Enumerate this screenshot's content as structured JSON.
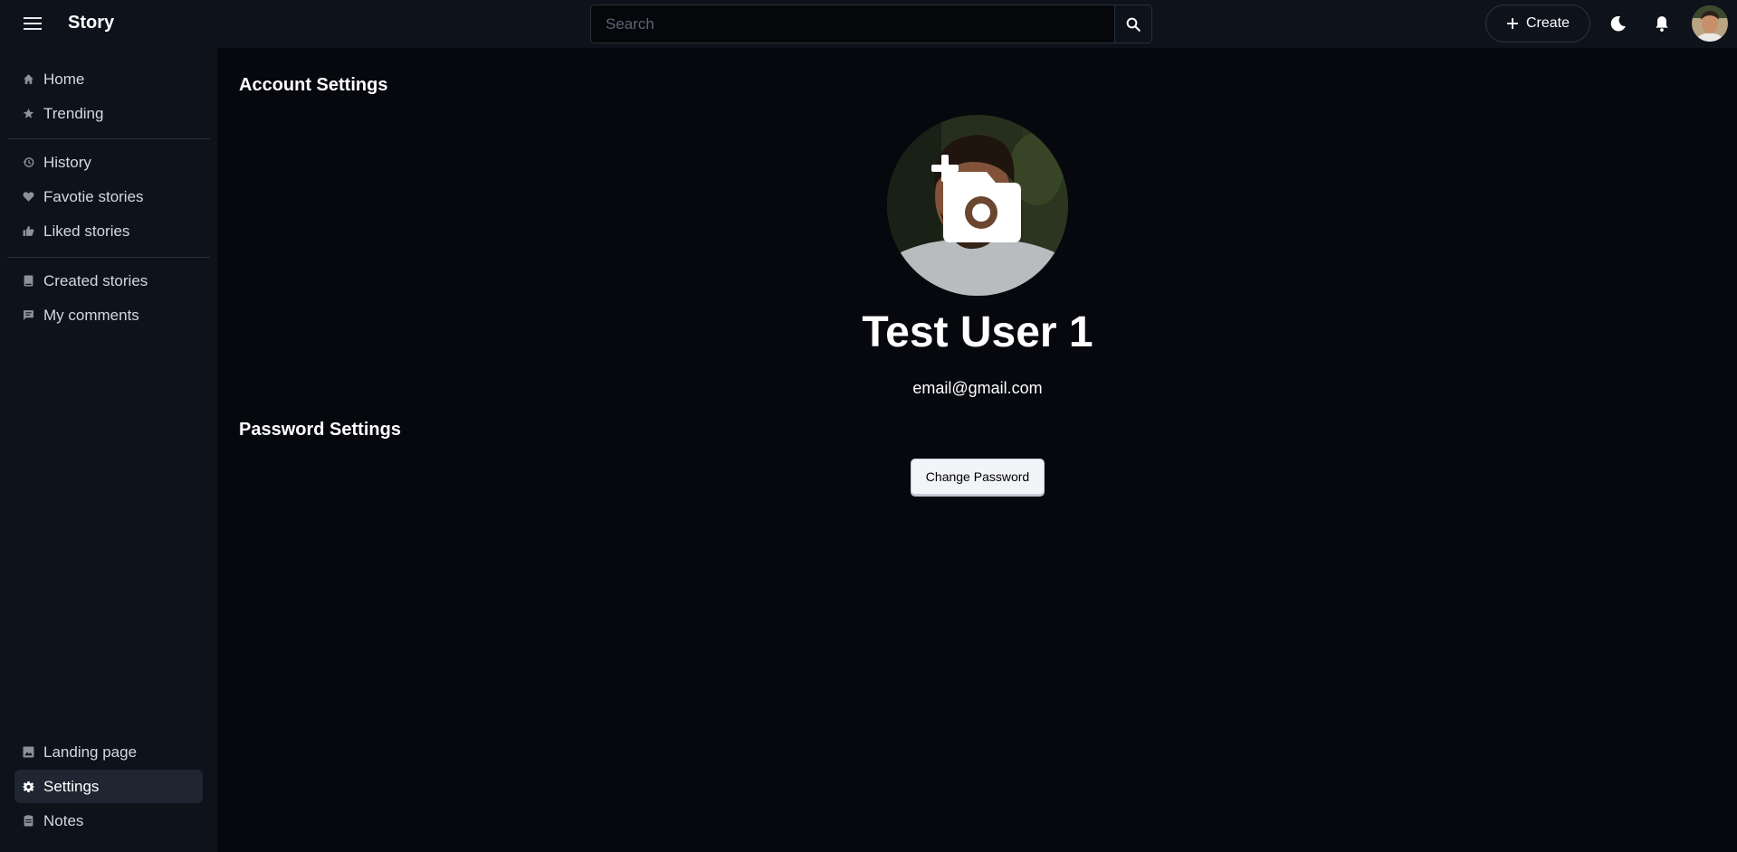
{
  "header": {
    "brand": "Story",
    "search_placeholder": "Search",
    "create_label": "Create"
  },
  "sidebar": {
    "group1": [
      {
        "label": "Home",
        "icon": "home-icon"
      },
      {
        "label": "Trending",
        "icon": "star-icon"
      }
    ],
    "group2": [
      {
        "label": "History",
        "icon": "history-icon"
      },
      {
        "label": "Favotie stories",
        "icon": "heart-icon"
      },
      {
        "label": "Liked stories",
        "icon": "thumbs-up-icon"
      }
    ],
    "group3": [
      {
        "label": "Created stories",
        "icon": "book-icon"
      },
      {
        "label": "My comments",
        "icon": "comment-icon"
      }
    ],
    "bottom": [
      {
        "label": "Landing page",
        "icon": "image-icon"
      },
      {
        "label": "Settings",
        "icon": "gear-icon",
        "active": true
      },
      {
        "label": "Notes",
        "icon": "notes-icon"
      }
    ]
  },
  "main": {
    "account_title": "Account Settings",
    "user_name": "Test User 1",
    "email": "email@gmail.com",
    "password_title": "Password Settings",
    "change_password_label": "Change Password"
  },
  "colors": {
    "background": "#06080d",
    "panel": "#0d121b",
    "active_item": "#1f2632",
    "text": "#ffffff"
  }
}
